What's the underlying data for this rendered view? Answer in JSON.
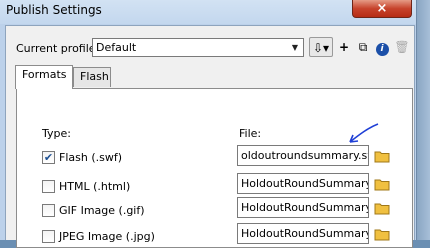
{
  "window": {
    "title": "Publish Settings",
    "close_glyph": "×"
  },
  "profile": {
    "label": "Current profile:",
    "value": "Default"
  },
  "toolbar": {
    "import_icon": "import-export-icon",
    "add_icon": "plus-icon",
    "duplicate_icon": "duplicate-icon",
    "info_icon": "info-icon",
    "trash_icon": "trash-icon"
  },
  "tabs": [
    {
      "label": "Formats"
    },
    {
      "label": "Flash"
    }
  ],
  "columns": {
    "type": "Type:",
    "file": "File:"
  },
  "formats": [
    {
      "label": "Flash  (.swf)",
      "checked": true,
      "file": "oldoutroundsummary.swf"
    },
    {
      "label": "HTML  (.html)",
      "checked": false,
      "file": "HoldoutRoundSummary.ht"
    },
    {
      "label": "GIF Image  (.gif)",
      "checked": false,
      "file": "HoldoutRoundSummary.gi"
    },
    {
      "label": "JPEG Image  (.jpg)",
      "checked": false,
      "file": "HoldoutRoundSummary.jp"
    }
  ],
  "colors": {
    "annotation_arrow": "#1f3fd6",
    "folder": "#f0c040"
  }
}
